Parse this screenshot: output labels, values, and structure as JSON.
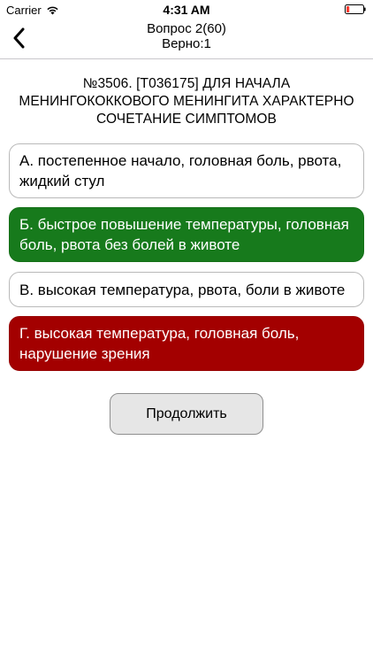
{
  "status_bar": {
    "carrier": "Carrier",
    "time": "4:31 AM",
    "wifi_icon": "wifi-icon",
    "battery_icon": "battery-icon",
    "battery_color": "#ff3b30"
  },
  "nav": {
    "back_icon": "chevron-left-icon",
    "title": "Вопрос 2(60)",
    "subtitle": "Верно:1"
  },
  "question": {
    "text": "№3506. [Т036175] ДЛЯ НАЧАЛА МЕНИНГОКОККОВОГО МЕНИНГИТА ХАРАКТЕРНО СОЧЕТАНИЕ СИМПТОМОВ"
  },
  "answers": [
    {
      "text": "А.  постепенное начало, головная боль, рвота, жидкий стул",
      "state": "neutral"
    },
    {
      "text": "Б.  быстрое повышение температуры, головная боль, рвота без болей в животе",
      "state": "correct",
      "color": "#177a1c"
    },
    {
      "text": "В.  высокая температура, рвота, боли в животе",
      "state": "neutral"
    },
    {
      "text": "Г.  высокая температура, головная боль, нарушение зрения",
      "state": "wrong",
      "color": "#a30000"
    }
  ],
  "continue_button": {
    "label": "Продолжить"
  }
}
